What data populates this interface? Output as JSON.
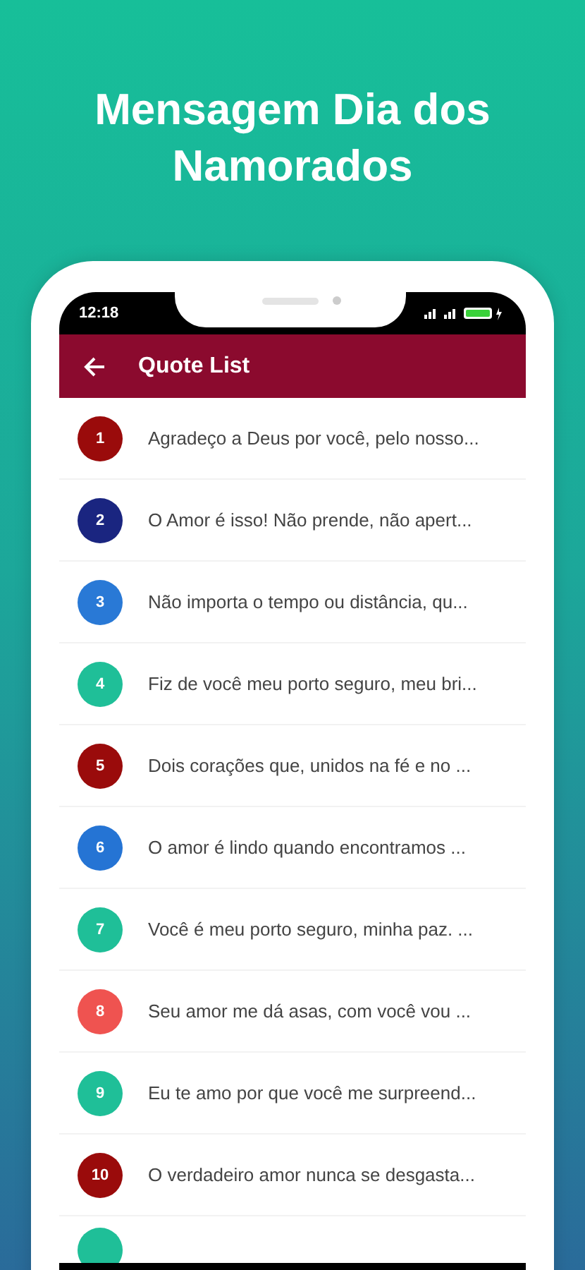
{
  "headline": "Mensagem Dia dos Namorados",
  "status_bar": {
    "time": "12:18"
  },
  "app_bar": {
    "title": "Quote List"
  },
  "quotes": [
    {
      "number": "1",
      "text": "Agradeço a Deus por você, pelo nosso...",
      "color": "#9a0b0b"
    },
    {
      "number": "2",
      "text": "O Amor é isso! Não prende, não apert...",
      "color": "#1a2580"
    },
    {
      "number": "3",
      "text": "Não importa o tempo ou distância, qu...",
      "color": "#2979d6"
    },
    {
      "number": "4",
      "text": "Fiz de você meu porto seguro, meu bri...",
      "color": "#1fbf98"
    },
    {
      "number": "5",
      "text": "Dois corações que, unidos na fé e no ...",
      "color": "#9a0b0b"
    },
    {
      "number": "6",
      "text": "O amor é lindo quando encontramos ...",
      "color": "#2574d4"
    },
    {
      "number": "7",
      "text": "Você é meu porto seguro, minha paz. ...",
      "color": "#1fbf98"
    },
    {
      "number": "8",
      "text": "Seu amor me dá asas, com você vou ...",
      "color": "#ef5350"
    },
    {
      "number": "9",
      "text": "Eu te amo por que você me surpreend...",
      "color": "#1fbf98"
    },
    {
      "number": "10",
      "text": "O verdadeiro amor nunca se desgasta...",
      "color": "#9a0b0b"
    }
  ],
  "partial_quote": {
    "color": "#1fbf98"
  }
}
